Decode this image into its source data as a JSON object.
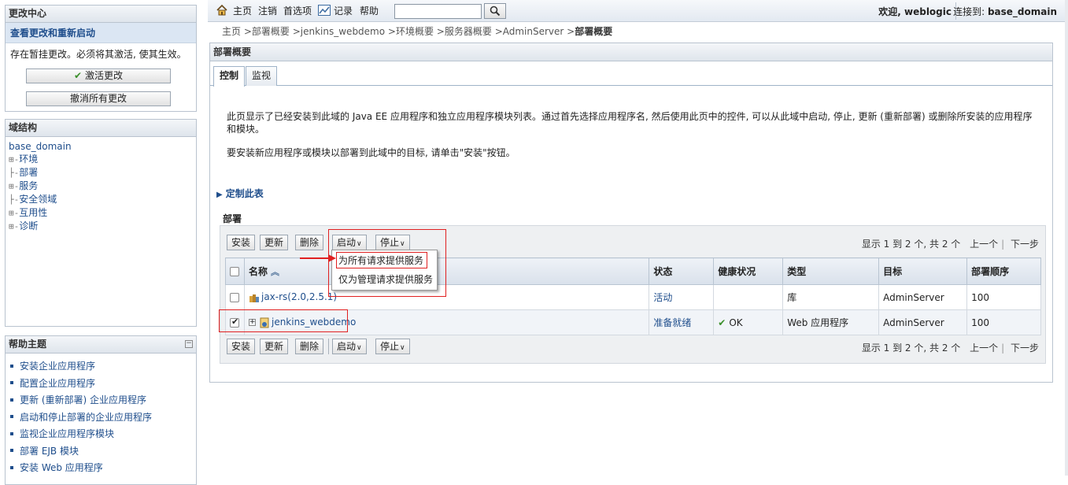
{
  "change_center": {
    "title": "更改中心",
    "link": "查看更改和重新启动",
    "message": "存在暂挂更改。必须将其激活, 使其生效。",
    "activate_label": "激活更改",
    "undo_label": "撤消所有更改"
  },
  "domain_structure": {
    "title": "域结构",
    "root": "base_domain",
    "items": [
      {
        "prefix": "⊞-",
        "label": "环境"
      },
      {
        "prefix": "├-",
        "label": "部署"
      },
      {
        "prefix": "⊞-",
        "label": "服务"
      },
      {
        "prefix": "├-",
        "label": "安全领域"
      },
      {
        "prefix": "⊞-",
        "label": "互用性"
      },
      {
        "prefix": "⊞-",
        "label": "诊断"
      }
    ]
  },
  "help_topics": {
    "title": "帮助主题",
    "collapse": "−",
    "items": [
      "安装企业应用程序",
      "配置企业应用程序",
      "更新 (重新部署) 企业应用程序",
      "启动和停止部署的企业应用程序",
      "监视企业应用程序模块",
      "部署 EJB 模块",
      "安装 Web 应用程序"
    ]
  },
  "topbar": {
    "home": "主页",
    "logout": "注销",
    "preferences": "首选项",
    "record": "记录",
    "help": "帮助",
    "search_value": "",
    "welcome": "欢迎, weblogic",
    "connected_label": "连接到:",
    "connected_domain": "base_domain"
  },
  "breadcrumb": {
    "home": "主页",
    "deployments": "部署概要",
    "app": "jenkins_webdemo",
    "env": "环境概要",
    "servers": "服务器概要",
    "server": "AdminServer",
    "current": "部署概要"
  },
  "main": {
    "title": "部署概要",
    "tabs": [
      "控制",
      "监视"
    ],
    "desc1": "此页显示了已经安装到此域的 Java EE 应用程序和独立应用程序模块列表。通过首先选择应用程序名, 然后使用此页中的控件, 可以从此域中启动, 停止, 更新 (重新部署) 或删除所安装的应用程序和模块。",
    "desc2": "要安装新应用程序或模块以部署到此域中的目标, 请单击\"安装\"按钮。",
    "customize": "定制此表",
    "deploy_title": "部署"
  },
  "toolbar": {
    "install": "安装",
    "update": "更新",
    "delete": "删除",
    "start": "启动",
    "stop": "停止",
    "pager": "显示 1 到 2 个, 共 2 个",
    "prev": "上一个",
    "next": "下一步"
  },
  "start_menu": {
    "all_requests": "为所有请求提供服务",
    "admin_requests": "仅为管理请求提供服务"
  },
  "table": {
    "headers": [
      "名称",
      "状态",
      "健康状况",
      "类型",
      "目标",
      "部署顺序"
    ],
    "rows": [
      {
        "name": "jax-rs(2.0,2.5.1)",
        "state": "活动",
        "health": "",
        "type": "库",
        "target": "AdminServer",
        "order": "100",
        "checked": false
      },
      {
        "name": "jenkins_webdemo",
        "state": "准备就绪",
        "health": "OK",
        "type": "Web 应用程序",
        "target": "AdminServer",
        "order": "100",
        "checked": true
      }
    ]
  },
  "colors": {
    "link": "#1f4e8c",
    "annotation": "#e02020",
    "ok": "#3a8f2a"
  }
}
